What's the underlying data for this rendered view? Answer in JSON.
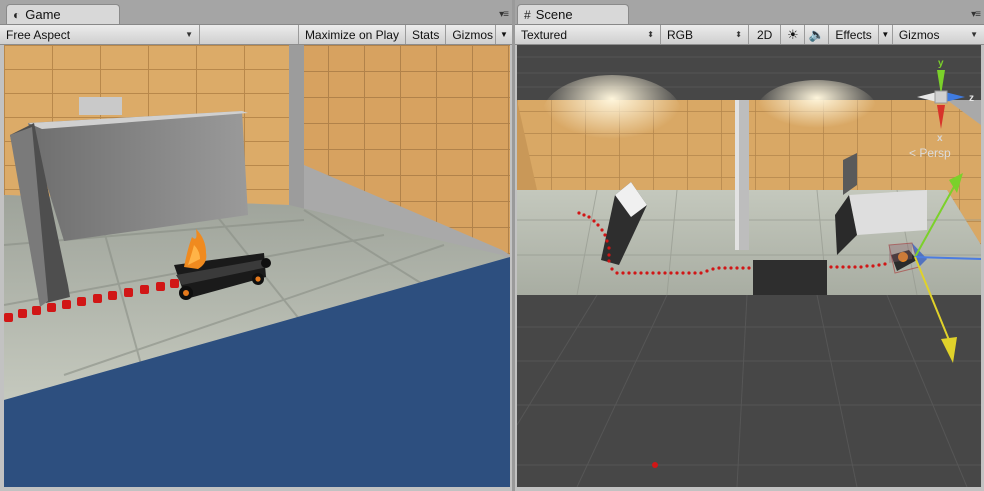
{
  "game": {
    "tab_label": "Game",
    "aspect_label": "Free Aspect",
    "maximize_label": "Maximize on Play",
    "stats_label": "Stats",
    "gizmos_label": "Gizmos"
  },
  "scene": {
    "tab_label": "Scene",
    "shading_label": "Textured",
    "color_label": "RGB",
    "mode_2d_label": "2D",
    "effects_label": "Effects",
    "gizmos_label": "Gizmos",
    "axis_y": "y",
    "axis_x": "x",
    "axis_z": "z",
    "persp_label": "< Persp"
  },
  "icons": {
    "game_tab": "unity-logo-icon",
    "scene_tab": "grid-icon",
    "menu": "tab-menu-icon",
    "lighting": "sun-icon",
    "audio": "speaker-icon"
  },
  "colors": {
    "wall": "#d9a561",
    "floor": "#b4b8ad",
    "water": "#2d4f7f",
    "trail": "#d11616",
    "grid_bg": "#474747"
  }
}
